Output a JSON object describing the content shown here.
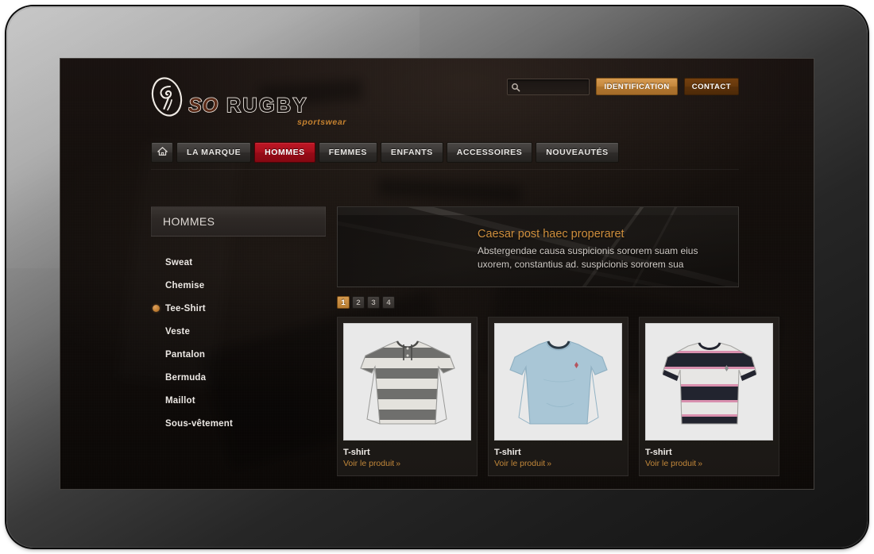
{
  "site": {
    "logo": {
      "word": "SO RUGBY",
      "tagline": "sportswear",
      "mark": "rugby-ball-swirl-icon"
    },
    "header": {
      "search": {
        "value": "",
        "placeholder": "",
        "icon": "search-icon"
      },
      "buttons": [
        {
          "id": "identification",
          "label": "IDENTIFICATION"
        },
        {
          "id": "contact",
          "label": "CONTACT"
        }
      ]
    },
    "nav": {
      "home_icon": "home-icon",
      "items": [
        {
          "label": "LA MARQUE",
          "active": false
        },
        {
          "label": "HOMMES",
          "active": true
        },
        {
          "label": "FEMMES",
          "active": false
        },
        {
          "label": "ENFANTS",
          "active": false
        },
        {
          "label": "ACCESSOIRES",
          "active": false
        },
        {
          "label": "NOUVEAUTÉS",
          "active": false
        }
      ]
    },
    "sidebar": {
      "heading": "HOMMES",
      "items": [
        {
          "label": "Sweat",
          "active": false
        },
        {
          "label": "Chemise",
          "active": false
        },
        {
          "label": "Tee-Shirt",
          "active": true
        },
        {
          "label": "Veste",
          "active": false
        },
        {
          "label": "Pantalon",
          "active": false
        },
        {
          "label": "Bermuda",
          "active": false
        },
        {
          "label": "Maillot",
          "active": false
        },
        {
          "label": "Sous-vêtement",
          "active": false
        }
      ]
    },
    "banner": {
      "title": "Caesar post haec properaret",
      "line1": "Abstergendae causa suspicionis sororem suam eius",
      "line2": "uxorem, constantius ad. suspicionis sororem sua"
    },
    "pagination": {
      "pages": [
        "1",
        "2",
        "3",
        "4"
      ],
      "current": "1"
    },
    "products": [
      {
        "title": "T-shirt",
        "link": "Voir le produit",
        "chevron": "»",
        "image": "gray-white-striped-long-sleeve-henley"
      },
      {
        "title": "T-shirt",
        "link": "Voir le produit",
        "chevron": "»",
        "image": "light-blue-long-sleeve-crewneck"
      },
      {
        "title": "T-shirt",
        "link": "Voir le produit",
        "chevron": "»",
        "image": "white-navy-striped-short-sleeve-tee"
      }
    ],
    "colors": {
      "accent_orange": "#c2873a",
      "active_red": "#a8101d",
      "page_background": "#140f0c",
      "bezel_gray": "#9a9a9a"
    }
  }
}
